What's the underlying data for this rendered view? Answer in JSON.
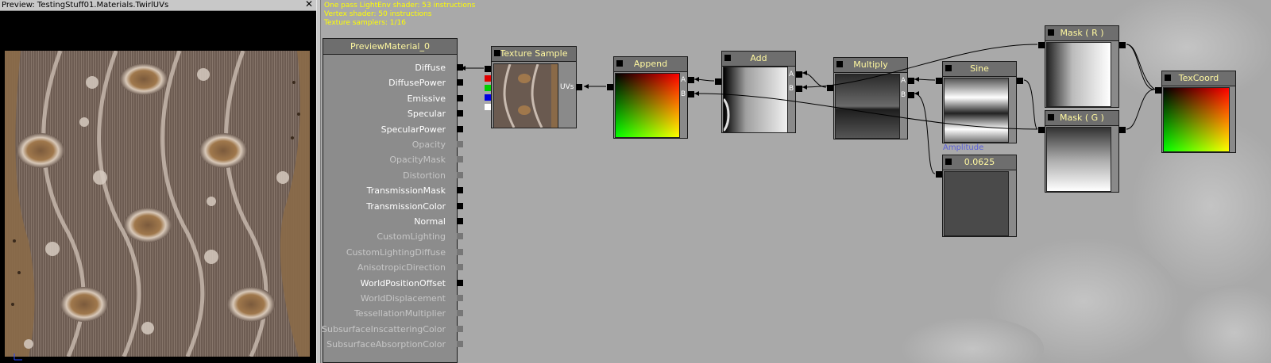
{
  "preview": {
    "title": "Preview: TestingStuff01.Materials.TwirlUVs",
    "close_glyph": "✕"
  },
  "stats": {
    "line1": "One pass LightEnv shader: 53 instructions",
    "line2": "Vertex shader: 50 instructions",
    "line3": "Texture samplers: 1/16"
  },
  "material": {
    "title": "PreviewMaterial_0",
    "inputs": [
      {
        "label": "Diffuse",
        "connected": true
      },
      {
        "label": "DiffusePower",
        "connected": true
      },
      {
        "label": "Emissive",
        "connected": true
      },
      {
        "label": "Specular",
        "connected": true
      },
      {
        "label": "SpecularPower",
        "connected": true
      },
      {
        "label": "Opacity",
        "connected": false
      },
      {
        "label": "OpacityMask",
        "connected": false
      },
      {
        "label": "Distortion",
        "connected": false
      },
      {
        "label": "TransmissionMask",
        "connected": true
      },
      {
        "label": "TransmissionColor",
        "connected": true
      },
      {
        "label": "Normal",
        "connected": true
      },
      {
        "label": "CustomLighting",
        "connected": false
      },
      {
        "label": "CustomLightingDiffuse",
        "connected": false
      },
      {
        "label": "AnisotropicDirection",
        "connected": false
      },
      {
        "label": "WorldPositionOffset",
        "connected": true
      },
      {
        "label": "WorldDisplacement",
        "connected": false
      },
      {
        "label": "TessellationMultiplier",
        "connected": false
      },
      {
        "label": "SubsurfaceInscatteringColor",
        "connected": false
      },
      {
        "label": "SubsurfaceAbsorptionColor",
        "connected": false
      }
    ]
  },
  "nodes": {
    "texture_sample": {
      "title": "Texture Sample",
      "input": "UVs"
    },
    "append": {
      "title": "Append",
      "in_a": "A",
      "in_b": "B"
    },
    "add": {
      "title": "Add",
      "in_a": "A",
      "in_b": "B"
    },
    "multiply": {
      "title": "Multiply",
      "in_a": "A",
      "in_b": "B"
    },
    "sine": {
      "title": "Sine",
      "caption": "Amplitude"
    },
    "constant": {
      "title": "0.0625"
    },
    "mask_r": {
      "title": "Mask ( R )"
    },
    "mask_g": {
      "title": "Mask ( G )"
    },
    "texcoord": {
      "title": "TexCoord"
    }
  },
  "colors": {
    "title_text": "#fff8a0",
    "stats_text": "#ffff00",
    "amplitude_text": "#5a60d8",
    "canvas_bg": "#a9a9a9"
  }
}
